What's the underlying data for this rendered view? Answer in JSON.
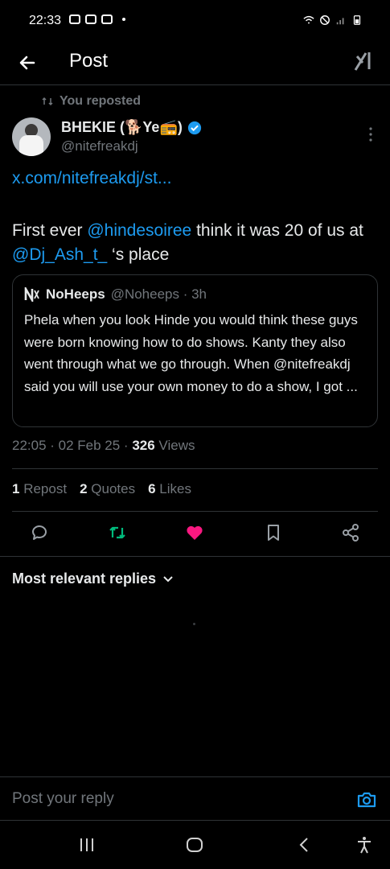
{
  "status_bar": {
    "time": "22:33"
  },
  "header": {
    "title": "Post"
  },
  "repost": {
    "label": "You reposted"
  },
  "author": {
    "display_name": "BHEKIE (🐕Ye📻)",
    "handle": "@nitefreakdj"
  },
  "tweet": {
    "link": "x.com/nitefreakdj/st...",
    "text_1": "First ever ",
    "mention_1": "@hindesoiree",
    "text_2": " think it was 20 of us at ",
    "mention_2": "@Dj_Ash_t_",
    "text_3": " ‘s place"
  },
  "quote": {
    "name": "NoHeeps",
    "meta": "@Noheeps · 3h",
    "body": "Phela when you look Hinde you would think these guys were born knowing how to do shows. Kanty they also went through what we go through. When @nitefreakdj said you will use your own money to do a show, I got ..."
  },
  "meta": {
    "timestamp": "22:05 · 02 Feb 25 · ",
    "views_count": "326",
    "views_label": " Views"
  },
  "stats": {
    "reposts_count": "1",
    "reposts_label": "Repost",
    "quotes_count": "2",
    "quotes_label": "Quotes",
    "likes_count": "6",
    "likes_label": "Likes"
  },
  "replies": {
    "sort_label": "Most relevant replies"
  },
  "reply_bar": {
    "placeholder": "Post your reply"
  },
  "colors": {
    "accent": "#1d9bf0",
    "like": "#f91880",
    "repost": "#00ba7c",
    "muted": "#71767b"
  }
}
